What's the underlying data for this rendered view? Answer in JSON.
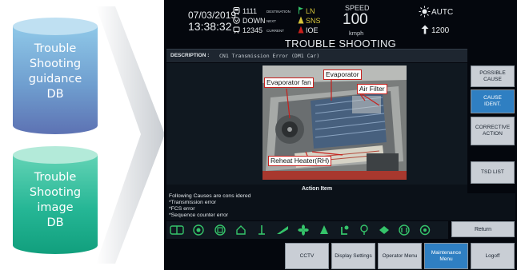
{
  "databases": [
    {
      "label": "Trouble\nShooting\nguidance\nDB",
      "lines": [
        "Trouble",
        "Shooting",
        "guidance",
        "DB"
      ]
    },
    {
      "label": "Trouble\nShooting\nimage\nDB",
      "lines": [
        "Trouble",
        "Shooting",
        "image",
        "DB"
      ]
    }
  ],
  "header": {
    "date": "07/03/2019",
    "time": "13:38:32",
    "train_no": "1111",
    "direction": "DOWN",
    "car_no": "12345",
    "destination_label": "DESTINATION",
    "next_label": "NEXT",
    "current_label": "CURRENT",
    "destination": "LN",
    "next": "SNS",
    "current": "IOE",
    "speed_label": "SPEED",
    "speed_value": "100",
    "speed_unit": "kmph",
    "mode": "AUTC",
    "power": "1200"
  },
  "page_title": "TROUBLE SHOOTING",
  "description": {
    "label": "DESCRIPTION :",
    "value": "CN1 Transmission Error (DM1 Car)"
  },
  "image_callouts": {
    "evaporator_fan": "Evaporator  fan",
    "evaporator": "Evaporator",
    "air_filter": "Air Filter",
    "reheat_heater": "Reheat  Heater(RH)"
  },
  "action_item": {
    "title": "Action Item",
    "lines": [
      "Following Causes are cons idered",
      " *Transmission error",
      " *FCS error",
      " *Sequence counter error"
    ]
  },
  "side_buttons": {
    "possible_cause": "POSSIBLE\nCAUSE",
    "cause_ident": "CAUSE\nIDENT.",
    "corrective_action": "CORRECTIVE\nACTION",
    "tsd_list": "TSD LIST"
  },
  "bottom_bar": {
    "return": "Return",
    "cctv": "CCTV",
    "display_settings": "Display Settings",
    "operator_menu": "Operator Menu",
    "maintenance_menu": "Maintenance\nMenu",
    "logoff": "Logoff"
  },
  "status_icons": [
    "door-icon",
    "brake-icon",
    "compressor-icon",
    "air-spring-icon",
    "pantograph-icon",
    "ventilation-icon",
    "fan-icon",
    "fire-icon",
    "power-icon",
    "location-icon",
    "horn-icon",
    "propulsion-icon",
    "light-icon"
  ],
  "colors": {
    "screen_bg": "#04070d",
    "active_button": "#2f7fc2",
    "button": "#c9ced5",
    "icon_green": "#35c46a",
    "callout_border": "#c8201c"
  }
}
